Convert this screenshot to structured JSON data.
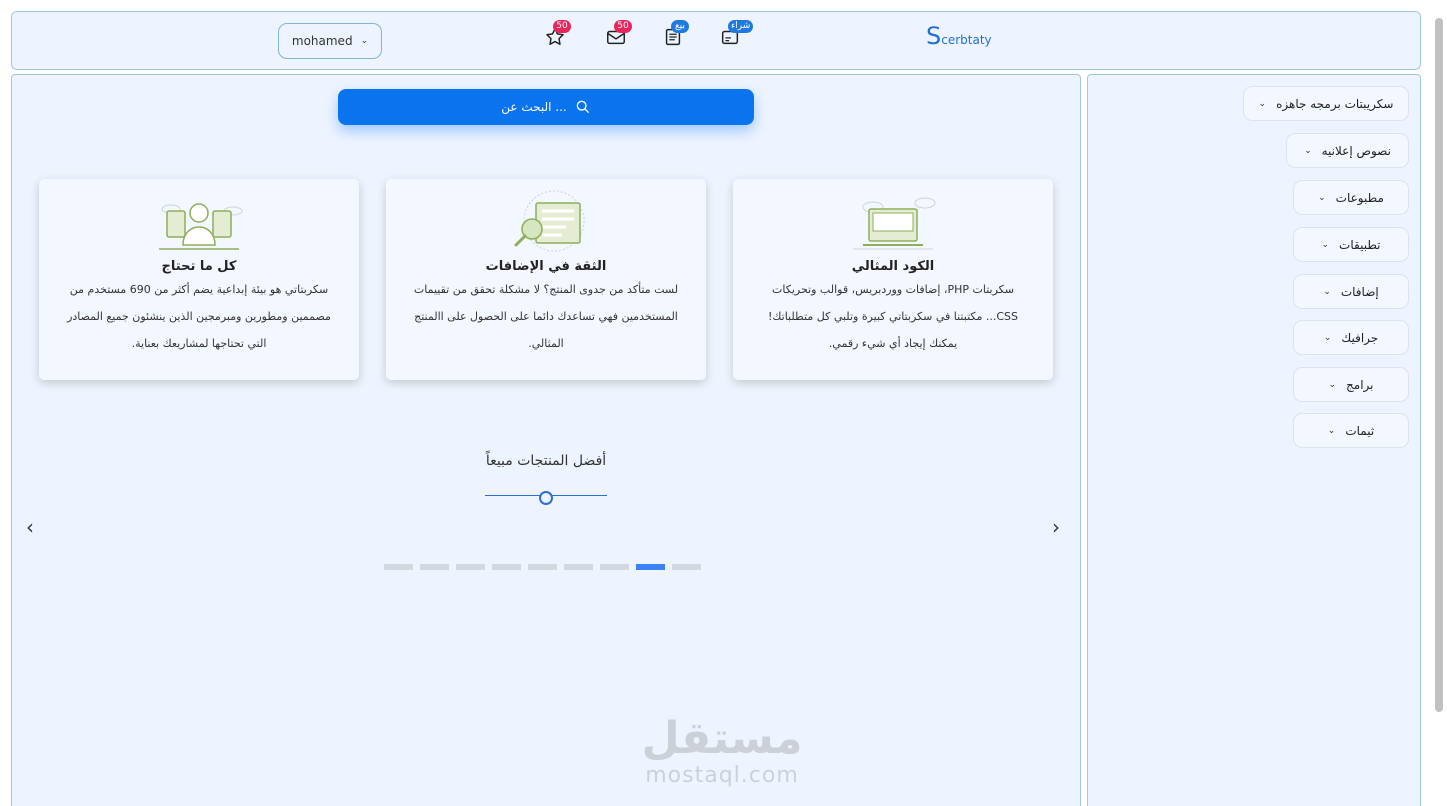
{
  "header": {
    "logo_initial": "S",
    "logo_rest": "cerbtaty",
    "user_name": "mohamed",
    "icons": [
      {
        "name": "buy-icon",
        "badge": "شراء"
      },
      {
        "name": "sell-icon",
        "badge": "بيع"
      },
      {
        "name": "messages-icon",
        "badge": "50"
      },
      {
        "name": "favorites-icon",
        "badge": "50"
      }
    ]
  },
  "search": {
    "placeholder": "البحث عن ..."
  },
  "cards": [
    {
      "title": "الكود المثالي",
      "text": "سكربتات PHP، إضافات ووردبريس، قوالب وتحريكات CSS... مكتبتنا في سكربتاتي كبيرة وتلبي كل متطلباتك! يمكنك إيجاد أي شيء رقمي."
    },
    {
      "title": "الثقة في الإضافات",
      "text": "لست متأكد من جدوى المنتج؟ لا مشكلة تحقق من تقييمات المستخدمين فهي تساعدك دائما على الحصول على االمنتج المثالي."
    },
    {
      "title": "كل ما تحتاج",
      "text": "سكربتاتي هو بيئة إبداعية يضم أكثر من 690 مستخدم من مصممين ومطورين ومبرمجين الذين ينشئون جميع المصادر التي تحتاجها لمشاريعك بعناية."
    }
  ],
  "best_sellers": {
    "title": "أفضل المنتجات مبيعاً",
    "slide_count": 9,
    "active_slide": 8
  },
  "sidebar": {
    "items": [
      {
        "label": "سكريبتات برمجه جاهزه"
      },
      {
        "label": "نصوص إعلانيه"
      },
      {
        "label": "مطبوعات"
      },
      {
        "label": "تطبيقات"
      },
      {
        "label": "إضافات"
      },
      {
        "label": "جرافيك"
      },
      {
        "label": "برامج"
      },
      {
        "label": "ثيمات"
      }
    ]
  },
  "watermark": {
    "arabic": "مستقل",
    "latin": "mostaql.com"
  },
  "colors": {
    "accent": "#0a74ee",
    "badge_red": "#e8265a",
    "badge_blue": "#1f7ae0",
    "panel_bg": "#eef4ff"
  }
}
